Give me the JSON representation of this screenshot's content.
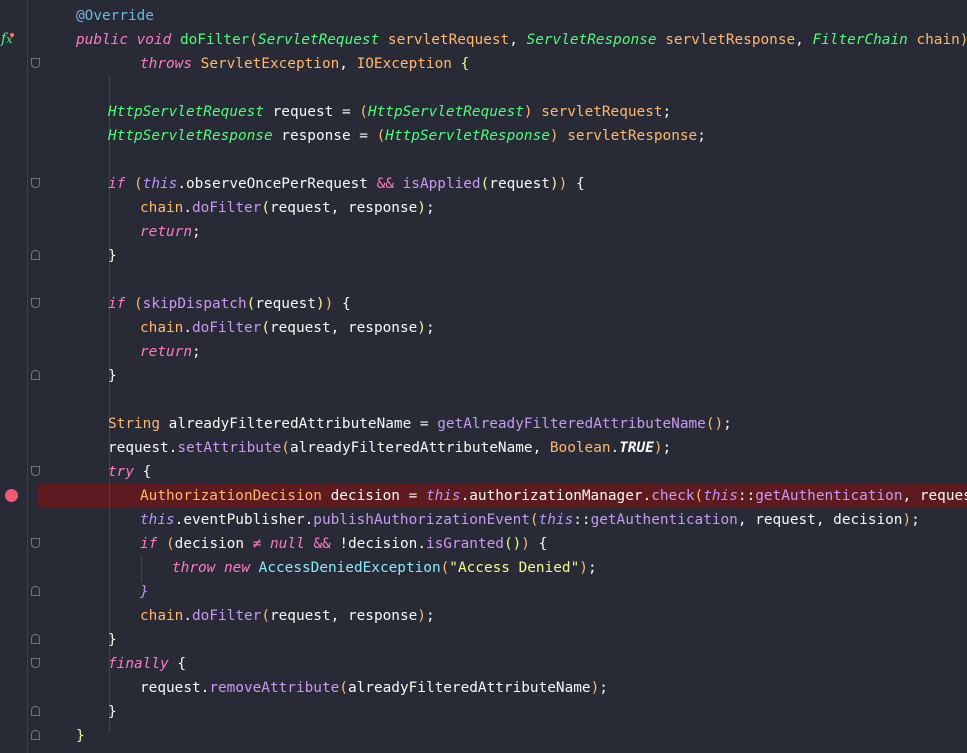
{
  "code": {
    "annotation": "@Override",
    "signature": {
      "modifiers": "public void ",
      "method": "doFilter",
      "open": "(",
      "p1_type": "ServletRequest",
      "p1_name": "servletRequest",
      "p2_type": "ServletResponse",
      "p2_name": "servletResponse",
      "p3_type": "FilterChain",
      "p3_name": "chain",
      "close": ")"
    },
    "throws_line": {
      "kw": "throws",
      "e1": "ServletException",
      "e2": "IOException",
      "brace": "{"
    },
    "cast_request": {
      "type": "HttpServletRequest",
      "var": "request",
      "eq": " = ",
      "cast": "HttpServletRequest",
      "src": "servletRequest"
    },
    "cast_response": {
      "type": "HttpServletResponse",
      "var": "response",
      "eq": " = ",
      "cast": "HttpServletResponse",
      "src": "servletResponse"
    },
    "if1": {
      "kw": "if",
      "this": "this",
      "field": "observeOncePerRequest",
      "and": "&&",
      "call": "isApplied",
      "arg": "request"
    },
    "chain_var": "chain",
    "do_filter": "doFilter",
    "do_filter_args": "request, response",
    "return_kw": "return",
    "if2": {
      "kw": "if",
      "call": "skipDispatch",
      "arg": "request"
    },
    "string_line": {
      "type": "String",
      "var": "alreadyFilteredAttributeName",
      "call": "getAlreadyFilteredAttributeName"
    },
    "set_attr": {
      "obj": "request",
      "call": "setAttribute",
      "arg1": "alreadyFilteredAttributeName",
      "cls": "Boolean",
      "const": "TRUE"
    },
    "try_kw": "try",
    "decision_line": {
      "type": "AuthorizationDecision",
      "var": "decision",
      "this": "this",
      "field": "authorizationManager",
      "call": "check",
      "ref": "getAuthentication",
      "arg": "request"
    },
    "publish_line": {
      "this": "this",
      "field": "eventPublisher",
      "call": "publishAuthorizationEvent",
      "ref": "getAuthentication",
      "args": "request, decision"
    },
    "if3": {
      "kw": "if",
      "var": "decision",
      "neq": "≠",
      "null_kw": "null",
      "and": "&&",
      "not_var": "!decision",
      "call": "isGranted"
    },
    "throw_line": {
      "throw_kw": "throw",
      "new_kw": "new",
      "cls": "AccessDeniedException",
      "str": "\"Access Denied\""
    },
    "finally_kw": "finally",
    "remove_line": {
      "obj": "request",
      "call": "removeAttribute",
      "arg": "alreadyFilteredAttributeName"
    }
  },
  "colors": {
    "background": "#282a36",
    "breakpoint": "#ef5a6f",
    "breakpoint_line": "#5e1b1f"
  }
}
